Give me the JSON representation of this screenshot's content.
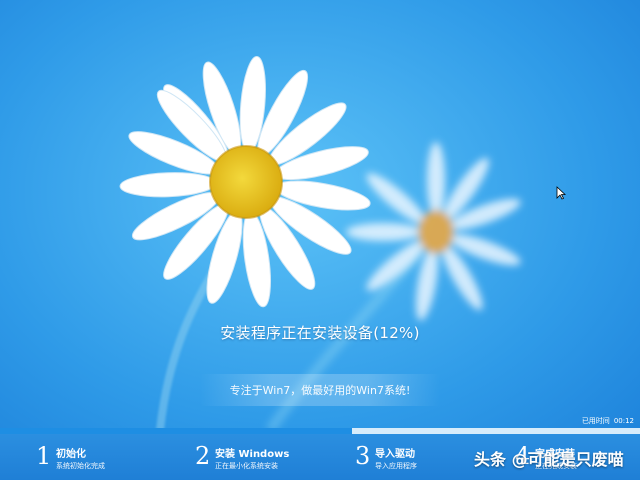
{
  "status_text": "安装程序正在安装设备(12%)",
  "slogan": "专注于Win7，做最好用的Win7系统!",
  "elapsed": {
    "label": "已用时间",
    "value": "00:12"
  },
  "progress_value": 0.55,
  "steps": [
    {
      "number": "1",
      "title": "初始化",
      "subtitle": "系统初始化完成"
    },
    {
      "number": "2",
      "title": "安装 Windows",
      "subtitle": "正在最小化系统安装"
    },
    {
      "number": "3",
      "title": "导入驱动",
      "subtitle": "导入应用程序"
    },
    {
      "number": "4",
      "title": "完成安装",
      "subtitle": "正在完成安装"
    }
  ],
  "watermark": "头条 @可能是只废喵",
  "colors": {
    "sky": "#2f9be8",
    "progress_fill": "#1e8ee3",
    "progress_track": "#d7ecfb",
    "daisy_center": "#e8c21a"
  }
}
